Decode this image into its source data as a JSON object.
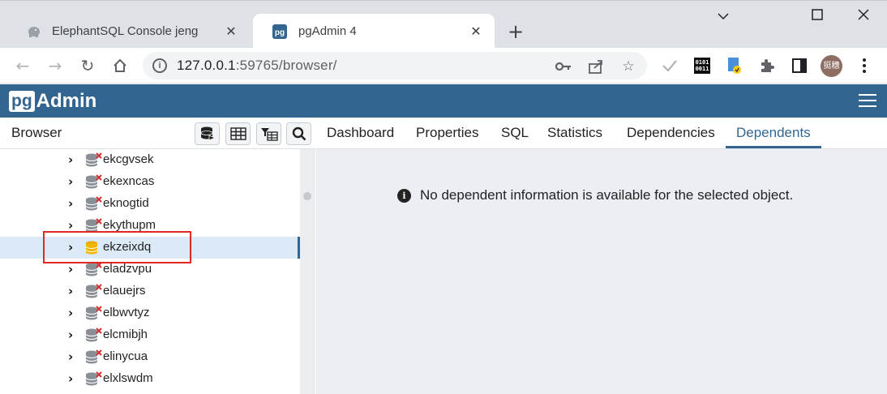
{
  "browser": {
    "tabs": [
      {
        "title": "ElephantSQL Console jeng",
        "favicon": "elephant-icon",
        "active": false
      },
      {
        "title": "pgAdmin 4",
        "favicon": "pgadmin-icon",
        "active": true
      }
    ],
    "new_tab": "+",
    "address": {
      "host": "127.0.0.1",
      "rest": ":59765/browser/"
    },
    "profile_initials": "挺穗"
  },
  "pgadmin": {
    "logo_pg": "pg",
    "logo_admin": "Admin"
  },
  "browser_panel": {
    "title": "Browser",
    "tree_items": [
      {
        "label": "ekcgvsek",
        "selected": false,
        "status": "disconnected"
      },
      {
        "label": "ekexncas",
        "selected": false,
        "status": "disconnected"
      },
      {
        "label": "eknogtid",
        "selected": false,
        "status": "disconnected"
      },
      {
        "label": "ekythupm",
        "selected": false,
        "status": "disconnected"
      },
      {
        "label": "ekzeixdq",
        "selected": true,
        "status": "connected"
      },
      {
        "label": "eladzvpu",
        "selected": false,
        "status": "disconnected"
      },
      {
        "label": "elauejrs",
        "selected": false,
        "status": "disconnected"
      },
      {
        "label": "elbwvtyz",
        "selected": false,
        "status": "disconnected"
      },
      {
        "label": "elcmibjh",
        "selected": false,
        "status": "disconnected"
      },
      {
        "label": "elinycua",
        "selected": false,
        "status": "disconnected"
      },
      {
        "label": "elxlswdm",
        "selected": false,
        "status": "disconnected"
      }
    ]
  },
  "main_panel": {
    "tabs": [
      "Dashboard",
      "Properties",
      "SQL",
      "Statistics",
      "Dependencies",
      "Dependents"
    ],
    "active_tab": "Dependents",
    "message": "No dependent information is available for the selected object."
  },
  "colors": {
    "brand": "#326690",
    "selection_bg": "#dbeaf6",
    "annotation_box": "#e22727"
  }
}
